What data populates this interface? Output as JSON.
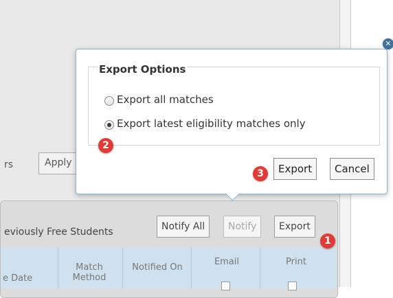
{
  "background": {
    "filters_label": "rs",
    "apply_label": "Apply",
    "section_title": "eviously Free Students",
    "buttons": {
      "notify_all": "Notify All",
      "notify": "Notify",
      "export": "Export"
    },
    "columns": [
      "e Date",
      "Match Method",
      "Notified On",
      "Email",
      "Print"
    ]
  },
  "popup": {
    "legend": "Export Options",
    "options": [
      {
        "label": "Export all matches",
        "checked": false
      },
      {
        "label": "Export latest eligibility matches only",
        "checked": true
      }
    ],
    "export_label": "Export",
    "cancel_label": "Cancel",
    "close_icon": "close-icon"
  },
  "annotations": [
    "1",
    "2",
    "3"
  ],
  "colors": {
    "badge": "#e23a36",
    "popup_border": "#8eb1d0",
    "header_bg": "#cfe0ee"
  }
}
